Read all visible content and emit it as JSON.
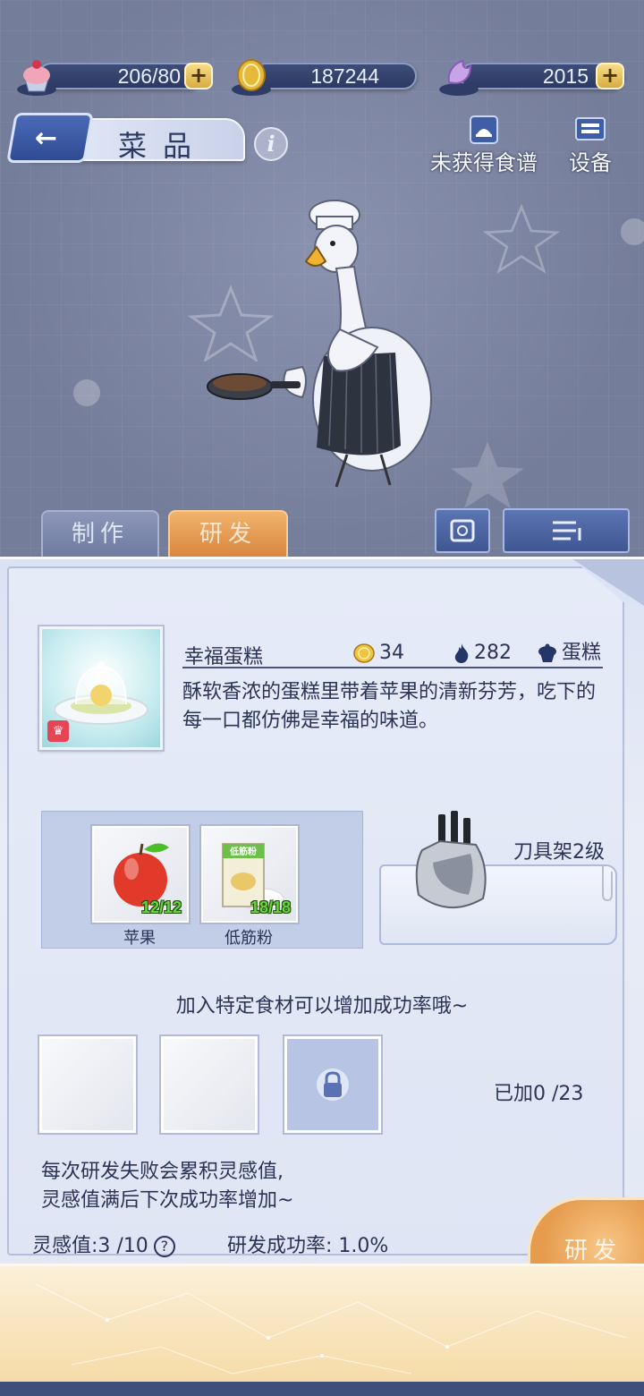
{
  "resources": [
    {
      "icon": "cupcake-icon",
      "value": "206/80",
      "has_plus": true
    },
    {
      "icon": "gold-coin-icon",
      "value": "187244",
      "has_plus": false
    },
    {
      "icon": "crystal-swan-icon",
      "value": "2015",
      "has_plus": true
    }
  ],
  "header": {
    "title": "菜品",
    "back_icon": "back-arrow-icon",
    "info_icon": "info-icon",
    "buttons": [
      {
        "label": "未获得食谱",
        "icon": "recipe-icon"
      },
      {
        "label": "设备",
        "icon": "equipment-icon"
      }
    ]
  },
  "tabs": [
    {
      "label": "制作",
      "active": false
    },
    {
      "label": "研发",
      "active": true
    }
  ],
  "tools": [
    {
      "icon": "preview-icon"
    },
    {
      "icon": "list-filter-icon"
    }
  ],
  "dish": {
    "name": "幸福蛋糕",
    "coin": "34",
    "heat": "282",
    "category": "蛋糕",
    "description": "酥软香浓的蛋糕里带着苹果的清新芬芳，吃下的每一口都仿佛是幸福的味道。"
  },
  "ingredients": [
    {
      "name": "苹果",
      "count": "12/12",
      "icon": "apple-icon"
    },
    {
      "name": "低筋粉",
      "count": "18/18",
      "icon": "flour-bag-icon",
      "package_text": "低筋粉"
    }
  ],
  "equipment": {
    "name": "刀具架2级",
    "icon": "knife-block-icon"
  },
  "hint": "加入特定食材可以增加成功率哦~",
  "added": "已加0 /23",
  "note_lines": [
    "每次研发失败会累积灵感值,",
    "灵感值满后下次成功率增加~"
  ],
  "inspiration": "灵感值:3 /10",
  "success_rate": "研发成功率:  1.0%",
  "research_button": "研发",
  "colors": {
    "accent_orange": "#e69b4d",
    "panel": "#e3e8f5",
    "scene": "#7d86a3"
  }
}
